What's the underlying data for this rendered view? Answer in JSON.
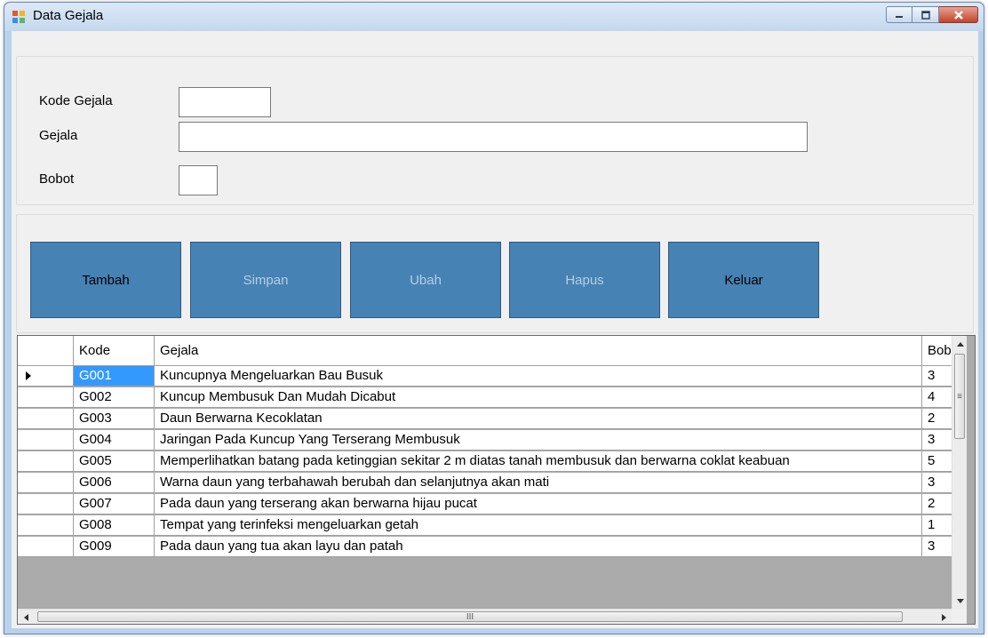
{
  "window": {
    "title": "Data Gejala",
    "icon": "form-icon"
  },
  "form": {
    "kode_label": "Kode Gejala",
    "kode_value": "",
    "gejala_label": "Gejala",
    "gejala_value": "",
    "bobot_label": "Bobot",
    "bobot_value": ""
  },
  "buttons": {
    "tambah": "Tambah",
    "simpan": "Simpan",
    "ubah": "Ubah",
    "hapus": "Hapus",
    "keluar": "Keluar"
  },
  "grid": {
    "columns": [
      "Kode",
      "Gejala",
      "Bobot"
    ],
    "rows": [
      {
        "kode": "G001",
        "gejala": "Kuncupnya Mengeluarkan Bau Busuk",
        "bobot": "3"
      },
      {
        "kode": "G002",
        "gejala": "Kuncup Membusuk Dan Mudah Dicabut",
        "bobot": "4"
      },
      {
        "kode": "G003",
        "gejala": "Daun Berwarna Kecoklatan",
        "bobot": "2"
      },
      {
        "kode": "G004",
        "gejala": "Jaringan Pada Kuncup Yang Terserang Membusuk",
        "bobot": "3"
      },
      {
        "kode": "G005",
        "gejala": "Memperlihatkan batang pada ketinggian sekitar 2 m diatas tanah membusuk dan berwarna coklat keabuan",
        "bobot": "5"
      },
      {
        "kode": "G006",
        "gejala": "Warna daun yang terbahawah berubah dan selanjutnya akan mati",
        "bobot": "3"
      },
      {
        "kode": "G007",
        "gejala": "Pada daun yang terserang akan berwarna hijau pucat",
        "bobot": "2"
      },
      {
        "kode": "G008",
        "gejala": "Tempat yang terinfeksi mengeluarkan getah",
        "bobot": "1"
      },
      {
        "kode": "G009",
        "gejala": "Pada daun yang tua akan layu dan patah",
        "bobot": "3"
      }
    ]
  },
  "colors": {
    "button_bg": "#4682b4",
    "selected_cell": "#3399ff"
  }
}
